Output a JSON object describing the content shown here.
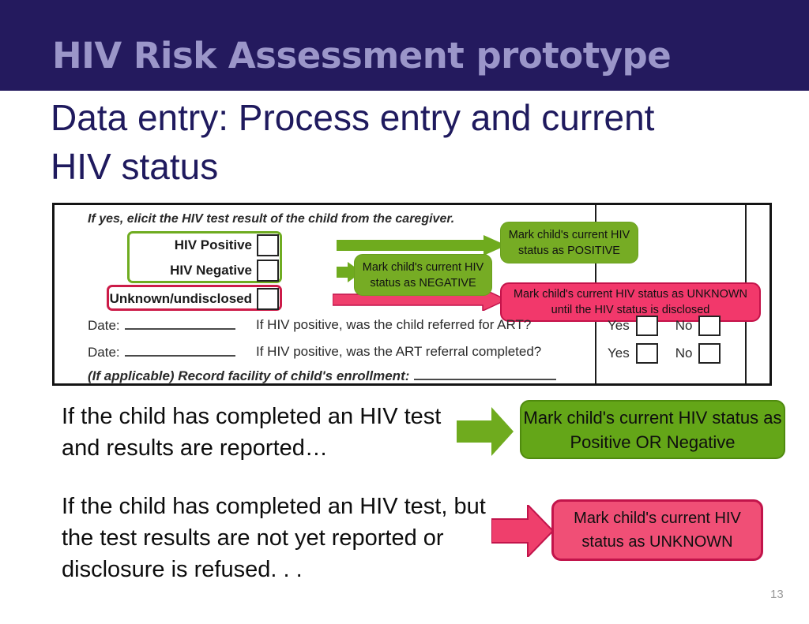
{
  "header": {
    "title": "HIV Risk Assessment prototype",
    "band_color": "#241a5e",
    "title_color": "#9b96c9"
  },
  "subtitle": {
    "text": "Data entry: Process entry and current HIV status",
    "color": "#1f1a5e"
  },
  "form": {
    "caption": "If yes, elicit the HIV test result of the child from the caregiver.",
    "options": [
      {
        "label": "HIV Positive",
        "checked": false
      },
      {
        "label": "HIV Negative",
        "checked": false
      },
      {
        "label": "Unknown/undisclosed",
        "checked": false
      }
    ],
    "highlight_green_color": "#6fac21",
    "highlight_pink_color": "#cc1b48",
    "date_rows": [
      {
        "label": "Date:",
        "value": ""
      },
      {
        "label": "Date:",
        "value": ""
      }
    ],
    "questions": [
      "If HIV positive, was the child referred for ART?",
      "If HIV positive, was the ART referral completed?"
    ],
    "yes_no": [
      {
        "yes_label": "Yes",
        "no_label": "No",
        "yes_checked": false,
        "no_checked": false
      },
      {
        "yes_label": "Yes",
        "no_label": "No",
        "yes_checked": false,
        "no_checked": false
      }
    ],
    "facility_line": "(If applicable) Record facility of child's enrollment:",
    "callouts": {
      "positive": "Mark child's current HIV status as POSITIVE",
      "negative": "Mark child's current HIV status as NEGATIVE",
      "unknown": "Mark child's current HIV status as UNKNOWN until the HIV status is disclosed"
    }
  },
  "explanations": [
    {
      "text": "If the child has completed an HIV test and results are reported…",
      "callout": "Mark child's current HIV status as Positive OR Negative",
      "callout_fill": "#64a618",
      "callout_border": "#4f8a0e",
      "arrow_fill": "#6fab1e"
    },
    {
      "text": "If the child has completed an HIV test, but the test results are not yet reported or disclosure is refused. . .",
      "callout": "Mark child's current HIV status as UNKNOWN",
      "callout_fill": "#f04f76",
      "callout_border": "#c2144b",
      "arrow_fill": "#ef3f6c"
    }
  ],
  "slide_number": "13"
}
